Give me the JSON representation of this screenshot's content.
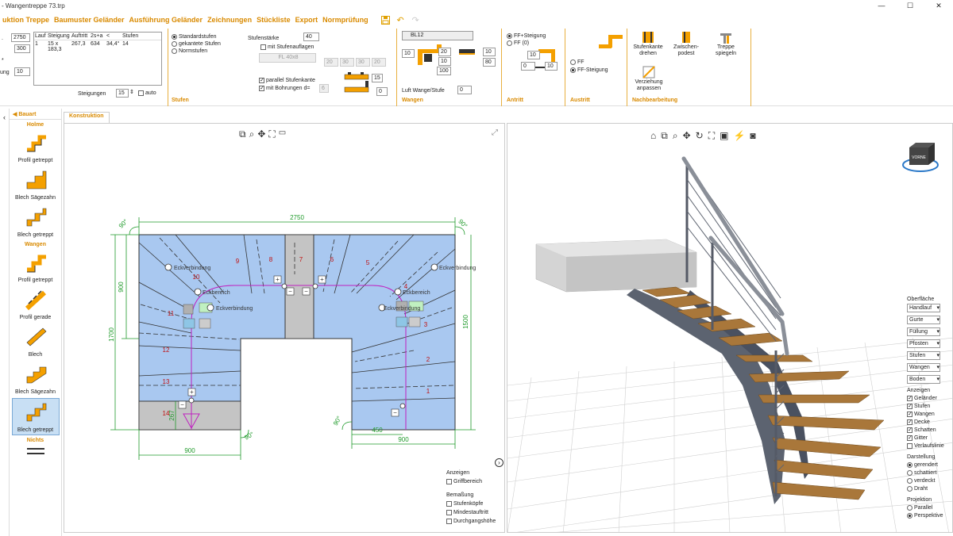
{
  "window": {
    "title": "- Wangentreppe 73.trp",
    "controls": [
      "—",
      "☐",
      "✕"
    ]
  },
  "menu": {
    "items": [
      "uktion Treppe",
      "Baumuster Geländer",
      "Ausführung Geländer",
      "Zeichnungen",
      "Stückliste",
      "Export",
      "Normprüfung"
    ],
    "icons": [
      "save-icon",
      "undo-icon",
      "redo-icon"
    ]
  },
  "ribbon": {
    "left": {
      "values": [
        "2750",
        "300",
        "10"
      ],
      "row_labels": [
        ".",
        "*",
        "ung"
      ],
      "table_headers": [
        "Lauf",
        "Steigung",
        "Auftritt",
        "2s+a",
        "<",
        "Stufen"
      ],
      "table_row": [
        "1",
        "15 x 183,3",
        "267,3",
        "634",
        "34,4°",
        "14"
      ],
      "steigungen_label": "Steigungen",
      "steigungen_value": "15",
      "auto_label": "auto"
    },
    "stufen": {
      "label": "Stufen",
      "radio": [
        "Standardstufen",
        "gekantete Stufen",
        "Normstufen"
      ],
      "staerke_label": "Stufenstärke",
      "staerke_value": "40",
      "auflagen": "mit Stufenauflagen",
      "fl": "FL 40x8",
      "dims": [
        "20",
        "30",
        "30",
        "20"
      ],
      "parallel": "parallel Stufenkante",
      "bohrungen": "mit Bohrungen",
      "bohrungen_d": "d=",
      "bohrungen_v": "6",
      "side_v": [
        "15",
        "0"
      ]
    },
    "wangen": {
      "label": "Wangen",
      "profile": "BL12",
      "vals": [
        "10",
        "20",
        "10",
        "10",
        "100",
        "80"
      ],
      "luft_label": "Luft Wange/Stufe",
      "luft_value": "0"
    },
    "antritt": {
      "label": "Antritt",
      "radio": [
        "FF+Steigung",
        "FF (0)"
      ],
      "vals": [
        "10",
        "0",
        "10"
      ]
    },
    "austritt": {
      "label": "Austritt",
      "radio": [
        "FF",
        "FF-Steigung"
      ]
    },
    "nach": {
      "label": "Nachbearbeitung",
      "buttons": [
        "Stufenkante drehen",
        "Zwischen-podest",
        "Treppe spiegeln",
        "Verziehung anpassen"
      ]
    }
  },
  "toolbox": {
    "tab": "Bauart",
    "holme": "Holme",
    "holme_items": [
      "Profil getreppt",
      "Blech Sägezahn",
      "Blech getreppt"
    ],
    "wangen": "Wangen",
    "wangen_items": [
      "Profil getreppt",
      "Profil gerade",
      "Blech",
      "Blech Sägezahn",
      "Blech getreppt"
    ],
    "nichts": "Nichts",
    "selected": "Blech getreppt"
  },
  "tabs": {
    "active": "Konstruktion"
  },
  "plan": {
    "dims": {
      "top": "2750",
      "left_outer": "1700",
      "left_inner": "900",
      "right": "1500",
      "bottom_left": "900",
      "bottom_r1": "450",
      "bottom_r2": "900",
      "small": "267",
      "ang1": "90°",
      "ang2": "90°",
      "ang3": "90°",
      "ang4": "90°"
    },
    "steps": [
      "1",
      "2",
      "3",
      "4",
      "5",
      "6",
      "7",
      "8",
      "9",
      "10",
      "11",
      "12",
      "13",
      "14"
    ],
    "labels": {
      "eck1": "Eckverbindung",
      "eck2": "Eckverbindung",
      "eck3": "Eckverbindung",
      "eck4": "Eckverbindung",
      "eckb1": "Eckbereich",
      "eckb2": "Eckbereich"
    }
  },
  "display2d": {
    "header": "Anzeigen",
    "items": [
      "Griffbereich"
    ],
    "bemassung": "Bemaßung",
    "bem_items": [
      "Stufenköpfe",
      "Mindestauftritt",
      "Durchgangshöhe"
    ]
  },
  "panel3d": {
    "oberflaeche": "Oberfläche",
    "selects": [
      "Handlauf",
      "Gurte",
      "Füllung",
      "Pfosten",
      "Stufen",
      "Wangen",
      "Boden"
    ],
    "anzeigen": "Anzeigen",
    "checks": [
      "Geländer",
      "Stufen",
      "Wangen",
      "Decke",
      "Schatten",
      "Gitter",
      "Verlaufslinie"
    ],
    "checked": [
      true,
      true,
      true,
      true,
      true,
      true,
      false
    ],
    "darstellung": "Darstellung",
    "d_radios": [
      "gerendert",
      "schattiert",
      "verdeckt",
      "Draht"
    ],
    "projektion": "Projektion",
    "p_radios": [
      "Parallel",
      "Perspektive"
    ],
    "cube": "VORNE"
  },
  "colors": {
    "accent": "#d98a00",
    "stair_blue": "#a9c8f0",
    "gray": "#c4c4c4",
    "dim_green": "#1f9a2a",
    "wood": "#a9773a"
  }
}
